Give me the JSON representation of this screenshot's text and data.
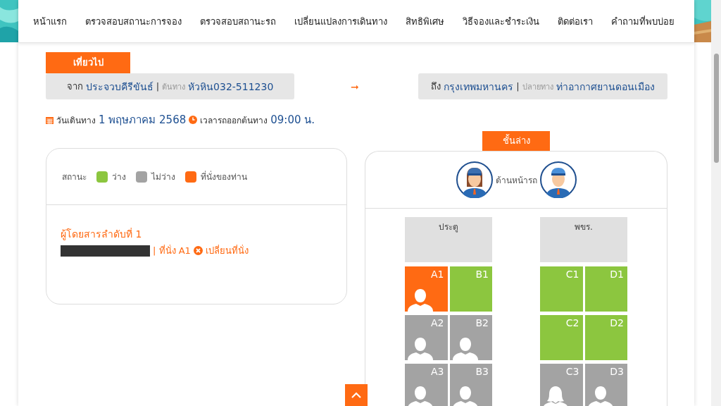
{
  "nav": [
    {
      "label": "หน้าแรก"
    },
    {
      "label": "ตรวจสอบสถานะการจอง"
    },
    {
      "label": "ตรวจสอบสถานะรถ"
    },
    {
      "label": "เปลี่ยนแปลงการเดินทาง"
    },
    {
      "label": "สิทธิพิเศษ"
    },
    {
      "label": "วิธีจองและชำระเงิน"
    },
    {
      "label": "ติดต่อเรา"
    },
    {
      "label": "คำถามที่พบบ่อย"
    }
  ],
  "trip_tab": "เที่ยวไป",
  "origin": {
    "prefix": "จาก",
    "city": "ประจวบคีรีขันธ์",
    "separator": "|",
    "stop_label": "ต้นทาง",
    "stop": "หัวหิน032-511230"
  },
  "arrow": "➞",
  "destination": {
    "prefix": "ถึง",
    "city": "กรุงเทพมหานคร",
    "separator": "|",
    "stop_label": "ปลายทาง",
    "stop": "ท่าอากาศยานดอนเมือง"
  },
  "date_label": "วันเดินทาง",
  "date": "1 พฤษภาคม 2568",
  "time_label": "เวลารถออกต้นทาง",
  "time": "09:00 น.",
  "legend": {
    "label": "สถานะ",
    "items": [
      {
        "label": "ว่าง",
        "color": "#8cc63f"
      },
      {
        "label": "ไม่ว่าง",
        "color": "#a3a3a3"
      },
      {
        "label": "ที่นั่งของท่าน",
        "color": "#ff6a13"
      }
    ]
  },
  "passenger": {
    "title": "ผู้โดยสารลำดับที่ 1",
    "name_redacted": true,
    "seat_text": "| ที่นั่ง A1",
    "change_link": "เปลี่ยนที่นั่ง"
  },
  "deck_tab": "ชั้นล่าง",
  "front_label": "ด้านหน้ารถ",
  "blocks": [
    {
      "label": "ประตู"
    },
    {
      "label": "พขร."
    }
  ],
  "seat_rows": [
    {
      "left": [
        {
          "label": "A1",
          "kind": "mine"
        },
        {
          "label": "B1",
          "kind": "free"
        }
      ],
      "right": [
        {
          "label": "C1",
          "kind": "free"
        },
        {
          "label": "D1",
          "kind": "free"
        }
      ]
    },
    {
      "left": [
        {
          "label": "A2",
          "kind": "taken"
        },
        {
          "label": "B2",
          "kind": "taken"
        }
      ],
      "right": [
        {
          "label": "C2",
          "kind": "free"
        },
        {
          "label": "D2",
          "kind": "free"
        }
      ]
    },
    {
      "left": [
        {
          "label": "A3",
          "kind": "taken"
        },
        {
          "label": "B3",
          "kind": "taken"
        }
      ],
      "right": [
        {
          "label": "C3",
          "kind": "takenwoman"
        },
        {
          "label": "D3",
          "kind": "taken"
        }
      ]
    }
  ]
}
